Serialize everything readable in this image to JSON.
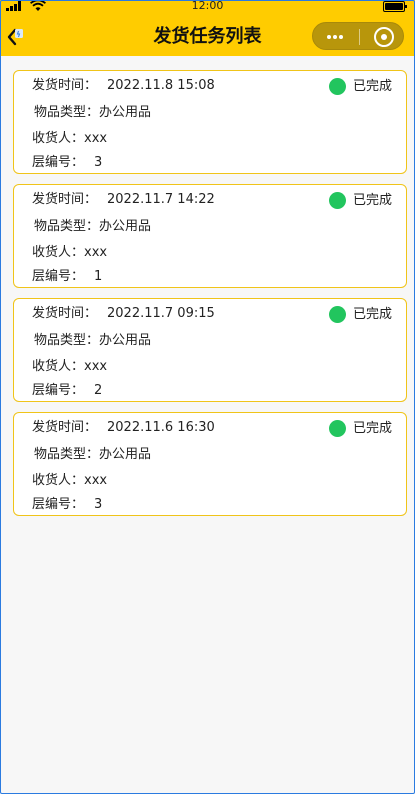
{
  "status_bar": {
    "time": "12:00"
  },
  "header": {
    "title": "发货任务列表",
    "back_icon": "chevron-left-icon",
    "menu_icon": "more-dots-icon",
    "close_icon": "target-circle-icon"
  },
  "colors": {
    "accent": "#ffcc00",
    "card_border": "#f0c419",
    "done": "#22c55e"
  },
  "labels": {
    "ship_time": "发货时间：",
    "item_type": "物品类型：",
    "receiver": "收货人：",
    "layer": "层编号："
  },
  "tasks": [
    {
      "ship_time": "2022.11.8 15:08",
      "item_type": "办公用品",
      "receiver": "xxx",
      "layer": "3",
      "status": "已完成"
    },
    {
      "ship_time": "2022.11.7 14:22",
      "item_type": "办公用品",
      "receiver": "xxx",
      "layer": "1",
      "status": "已完成"
    },
    {
      "ship_time": "2022.11.7 09:15",
      "item_type": "办公用品",
      "receiver": "xxx",
      "layer": "2",
      "status": "已完成"
    },
    {
      "ship_time": "2022.11.6 16:30",
      "item_type": "办公用品",
      "receiver": "xxx",
      "layer": "3",
      "status": "已完成"
    }
  ]
}
